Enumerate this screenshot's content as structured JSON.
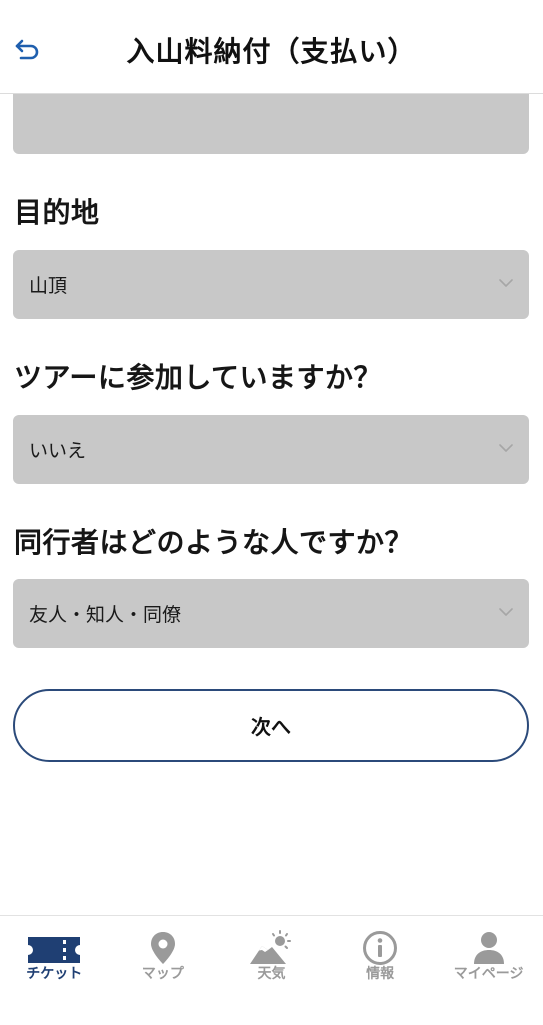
{
  "header": {
    "title": "入山料納付（支払い）",
    "back_icon": "back-arrow-icon"
  },
  "form": {
    "destination": {
      "label": "目的地",
      "value": "山頂"
    },
    "tour": {
      "label": "ツアーに参加していますか？",
      "value": "いいえ"
    },
    "companions": {
      "label": "同行者はどのような人ですか？",
      "value": "友人・知人・同僚"
    },
    "next_label": "次へ"
  },
  "tabs": [
    {
      "label": "チケット",
      "icon": "ticket-icon",
      "active": true
    },
    {
      "label": "マップ",
      "icon": "map-pin-icon",
      "active": false
    },
    {
      "label": "天気",
      "icon": "weather-mountain-icon",
      "active": false
    },
    {
      "label": "情報",
      "icon": "info-icon",
      "active": false
    },
    {
      "label": "マイページ",
      "icon": "person-icon",
      "active": false
    }
  ],
  "colors": {
    "accent": "#1f3f73",
    "button_border": "#2b4a7a",
    "field_bg": "#c8c8c8",
    "inactive_tab": "#9a9a9a"
  }
}
